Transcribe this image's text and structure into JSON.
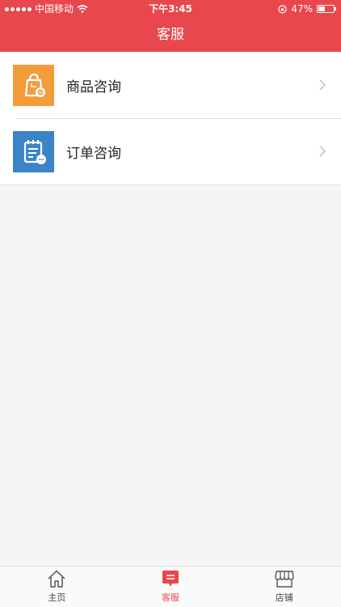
{
  "status_bar": {
    "carrier": "中国移动",
    "time": "下午3:45",
    "battery_text": "47%",
    "battery_level": 0.47
  },
  "nav": {
    "title": "客服"
  },
  "menu": {
    "items": [
      {
        "label": "商品咨询",
        "icon": "shopping-bag-icon",
        "color": "#f39c3a"
      },
      {
        "label": "订单咨询",
        "icon": "order-chat-icon",
        "color": "#3b84c7"
      }
    ]
  },
  "tabs": {
    "home": {
      "label": "主页",
      "icon": "home-icon"
    },
    "service": {
      "label": "客服",
      "icon": "chat-icon",
      "active": true
    },
    "store": {
      "label": "店铺",
      "icon": "store-icon"
    }
  },
  "colors": {
    "accent": "#e8474d",
    "background": "#f5f5f5"
  }
}
